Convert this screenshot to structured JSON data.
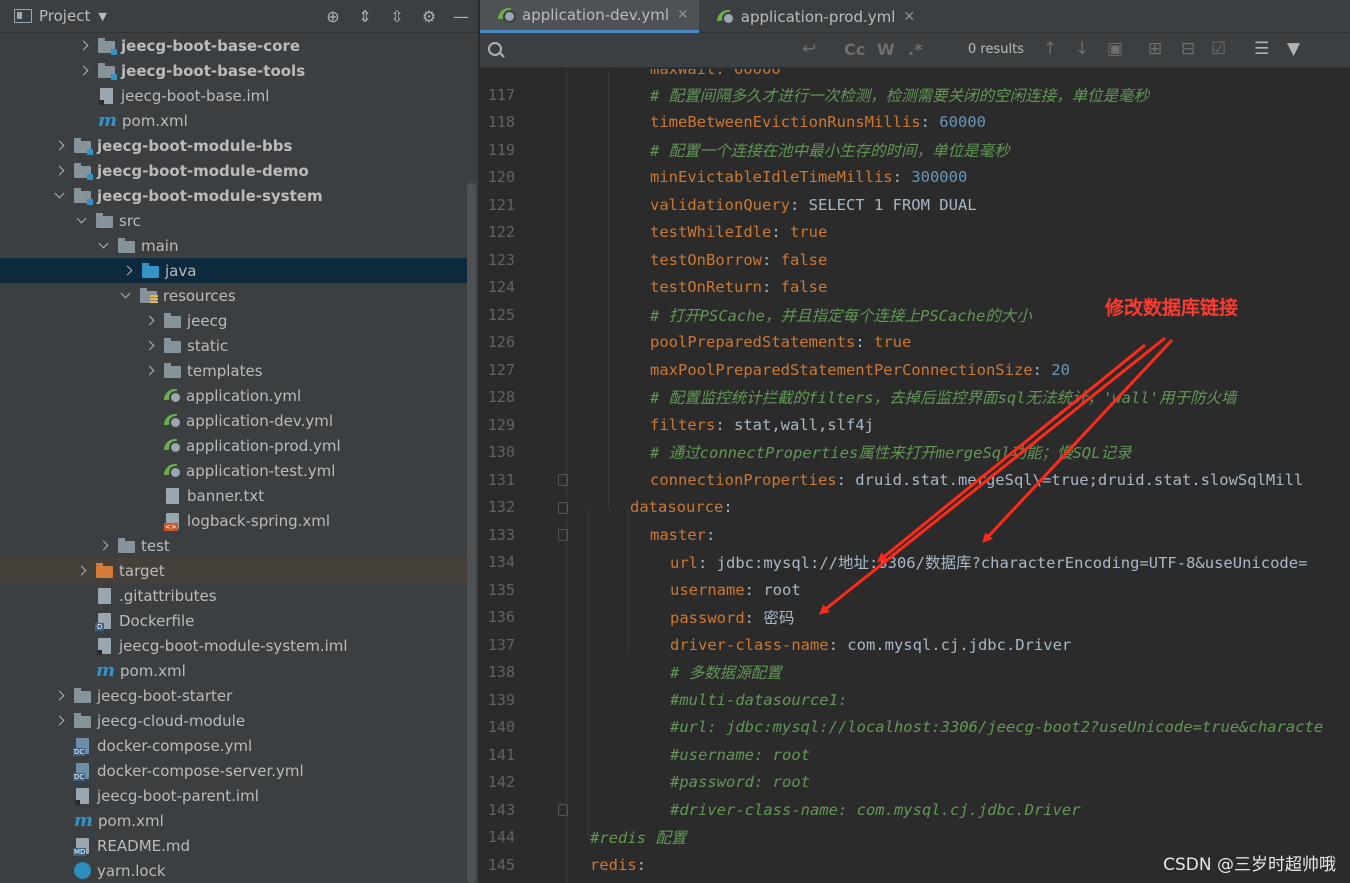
{
  "project_panel": {
    "title": "Project",
    "tree": [
      {
        "label": "jeecg-boot-base-core",
        "arrow": "r",
        "icon": "folder-mod",
        "bold": true
      },
      {
        "label": "jeecg-boot-base-tools",
        "arrow": "r",
        "icon": "folder-mod",
        "bold": true
      },
      {
        "label": "jeecg-boot-base.iml",
        "arrow": "n",
        "icon": "iml"
      },
      {
        "label": "pom.xml",
        "arrow": "n",
        "icon": "maven"
      },
      {
        "label": "jeecg-boot-module-bbs",
        "arrow": "r",
        "icon": "folder-mod",
        "bold": true
      },
      {
        "label": "jeecg-boot-module-demo",
        "arrow": "r",
        "icon": "folder-mod",
        "bold": true
      },
      {
        "label": "jeecg-boot-module-system",
        "arrow": "d",
        "icon": "folder-mod",
        "bold": true
      },
      {
        "label": "src",
        "arrow": "d",
        "icon": "folder"
      },
      {
        "label": "main",
        "arrow": "d",
        "icon": "folder"
      },
      {
        "label": "java",
        "arrow": "r",
        "icon": "folder-blue",
        "selected": true
      },
      {
        "label": "resources",
        "arrow": "d",
        "icon": "folder-res"
      },
      {
        "label": "jeecg",
        "arrow": "r",
        "icon": "folder"
      },
      {
        "label": "static",
        "arrow": "r",
        "icon": "folder"
      },
      {
        "label": "templates",
        "arrow": "r",
        "icon": "folder"
      },
      {
        "label": "application.yml",
        "arrow": "n",
        "icon": "spring"
      },
      {
        "label": "application-dev.yml",
        "arrow": "n",
        "icon": "spring"
      },
      {
        "label": "application-prod.yml",
        "arrow": "n",
        "icon": "spring"
      },
      {
        "label": "application-test.yml",
        "arrow": "n",
        "icon": "spring"
      },
      {
        "label": "banner.txt",
        "arrow": "n",
        "icon": "text"
      },
      {
        "label": "logback-spring.xml",
        "arrow": "n",
        "icon": "xml"
      },
      {
        "label": "test",
        "arrow": "r",
        "icon": "folder"
      },
      {
        "label": "target",
        "arrow": "r",
        "icon": "folder-orange",
        "highlight": true
      },
      {
        "label": ".gitattributes",
        "arrow": "n",
        "icon": "text"
      },
      {
        "label": "Dockerfile",
        "arrow": "n",
        "icon": "docker"
      },
      {
        "label": "jeecg-boot-module-system.iml",
        "arrow": "n",
        "icon": "iml"
      },
      {
        "label": "pom.xml",
        "arrow": "n",
        "icon": "maven"
      },
      {
        "label": "jeecg-boot-starter",
        "arrow": "r",
        "icon": "folder"
      },
      {
        "label": "jeecg-cloud-module",
        "arrow": "r",
        "icon": "folder"
      },
      {
        "label": "docker-compose.yml",
        "arrow": "n",
        "icon": "dc"
      },
      {
        "label": "docker-compose-server.yml",
        "arrow": "n",
        "icon": "dc"
      },
      {
        "label": "jeecg-boot-parent.iml",
        "arrow": "n",
        "icon": "iml"
      },
      {
        "label": "pom.xml",
        "arrow": "n",
        "icon": "maven"
      },
      {
        "label": "README.md",
        "arrow": "n",
        "icon": "md"
      },
      {
        "label": "yarn.lock",
        "arrow": "n",
        "icon": "yarn"
      }
    ]
  },
  "tabs": [
    {
      "label": "application-dev.yml",
      "active": true
    },
    {
      "label": "application-prod.yml",
      "active": false
    }
  ],
  "search": {
    "placeholder": "",
    "value": "",
    "match_case": "Cc",
    "words": "W",
    "regex": ".*",
    "results": "0 results"
  },
  "code": {
    "partial_top": "maxWait: 60000",
    "lines": [
      {
        "num": "117",
        "parts": [
          [
            "c",
            "# 配置间隔多久才进行一次检测，检测需要关闭的空闲连接，单位是毫秒"
          ]
        ]
      },
      {
        "num": "118",
        "parts": [
          [
            "k",
            "timeBetweenEvictionRunsMillis"
          ],
          [
            "v",
            ": "
          ],
          [
            "n",
            "60000"
          ]
        ]
      },
      {
        "num": "119",
        "parts": [
          [
            "c",
            "# 配置一个连接在池中最小生存的时间，单位是毫秒"
          ]
        ]
      },
      {
        "num": "120",
        "parts": [
          [
            "k",
            "minEvictableIdleTimeMillis"
          ],
          [
            "v",
            ": "
          ],
          [
            "n",
            "300000"
          ]
        ]
      },
      {
        "num": "121",
        "parts": [
          [
            "k",
            "validationQuery"
          ],
          [
            "v",
            ": SELECT 1 FROM DUAL"
          ]
        ]
      },
      {
        "num": "122",
        "parts": [
          [
            "k",
            "testWhileIdle"
          ],
          [
            "v",
            ": "
          ],
          [
            "k",
            "true"
          ]
        ]
      },
      {
        "num": "123",
        "parts": [
          [
            "k",
            "testOnBorrow"
          ],
          [
            "v",
            ": "
          ],
          [
            "k",
            "false"
          ]
        ]
      },
      {
        "num": "124",
        "parts": [
          [
            "k",
            "testOnReturn"
          ],
          [
            "v",
            ": "
          ],
          [
            "k",
            "false"
          ]
        ]
      },
      {
        "num": "125",
        "parts": [
          [
            "c",
            "# 打开PSCache，并且指定每个连接上PSCache的大小"
          ]
        ]
      },
      {
        "num": "126",
        "parts": [
          [
            "k",
            "poolPreparedStatements"
          ],
          [
            "v",
            ": "
          ],
          [
            "k",
            "true"
          ]
        ]
      },
      {
        "num": "127",
        "parts": [
          [
            "k",
            "maxPoolPreparedStatementPerConnectionSize"
          ],
          [
            "v",
            ": "
          ],
          [
            "n",
            "20"
          ]
        ]
      },
      {
        "num": "128",
        "parts": [
          [
            "c",
            "# 配置监控统计拦截的filters，去掉后监控界面sql无法统计，'wall'用于防火墙"
          ]
        ]
      },
      {
        "num": "129",
        "parts": [
          [
            "k",
            "filters"
          ],
          [
            "v",
            ": stat,wall,slf4j"
          ]
        ]
      },
      {
        "num": "130",
        "parts": [
          [
            "c",
            "# 通过connectProperties属性来打开mergeSql功能；慢SQL记录"
          ]
        ]
      },
      {
        "num": "131",
        "parts": [
          [
            "k",
            "connectionProperties"
          ],
          [
            "v",
            ": druid.stat.mergeSql\\=true;druid.stat.slowSqlMill"
          ]
        ]
      },
      {
        "num": "132",
        "parts": [
          [
            "k",
            "datasource"
          ],
          [
            "v",
            ":"
          ]
        ]
      },
      {
        "num": "133",
        "parts": [
          [
            "k",
            "master"
          ],
          [
            "v",
            ":"
          ]
        ]
      },
      {
        "num": "134",
        "parts": [
          [
            "k",
            "url"
          ],
          [
            "v",
            ": jdbc:mysql://地址:3306/数据库?characterEncoding=UTF-8&useUnicode="
          ]
        ]
      },
      {
        "num": "135",
        "parts": [
          [
            "k",
            "username"
          ],
          [
            "v",
            ": root"
          ]
        ]
      },
      {
        "num": "136",
        "parts": [
          [
            "k",
            "password"
          ],
          [
            "v",
            ": 密码"
          ]
        ]
      },
      {
        "num": "137",
        "parts": [
          [
            "k",
            "driver-class-name"
          ],
          [
            "v",
            ": com.mysql.cj.jdbc.Driver"
          ]
        ]
      },
      {
        "num": "138",
        "parts": [
          [
            "c",
            "# 多数据源配置"
          ]
        ]
      },
      {
        "num": "139",
        "parts": [
          [
            "c",
            "#multi-datasource1:"
          ]
        ]
      },
      {
        "num": "140",
        "parts": [
          [
            "c",
            "#url: jdbc:mysql://localhost:3306/jeecg-boot2?useUnicode=true&characte"
          ]
        ]
      },
      {
        "num": "141",
        "parts": [
          [
            "c",
            "#username: root"
          ]
        ]
      },
      {
        "num": "142",
        "parts": [
          [
            "c",
            "#password: root"
          ]
        ]
      },
      {
        "num": "143",
        "parts": [
          [
            "c",
            "#driver-class-name: com.mysql.cj.jdbc.Driver"
          ]
        ]
      },
      {
        "num": "144",
        "parts": [
          [
            "c",
            "#redis 配置"
          ]
        ]
      },
      {
        "num": "145",
        "parts": [
          [
            "k",
            "redis"
          ],
          [
            "v",
            ":"
          ]
        ]
      }
    ]
  },
  "annotation": "修改数据库链接",
  "watermark": "CSDN @三岁时超帅哦",
  "colors": {
    "key": "#cc7832",
    "comment": "#629755",
    "number": "#6897bb",
    "annotation": "#ff3b30",
    "selection": "#0d293e"
  }
}
